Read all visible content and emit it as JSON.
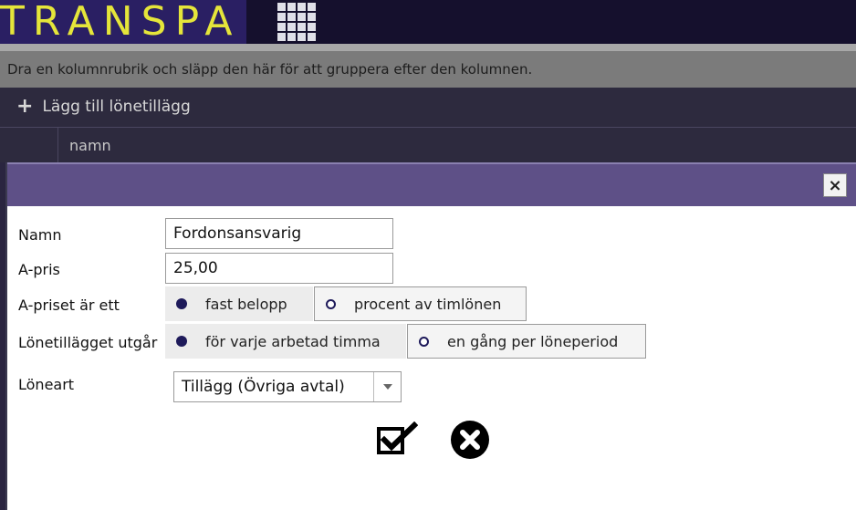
{
  "header": {
    "logo_text": "TRANSPA",
    "apps_icon": "grid-icon"
  },
  "grid": {
    "group_hint": "Dra en kolumnrubrik och släpp den här för att gruppera efter den kolumnen.",
    "add_label": "Lägg till lönetillägg",
    "column_name": "namn"
  },
  "dialog": {
    "close_label": "×",
    "fields": {
      "namn_label": "Namn",
      "namn_value": "Fordonsansvarig",
      "apris_label": "A-pris",
      "apris_value": "25,00",
      "apris_type_label": "A-priset är ett",
      "apris_opt1": "fast belopp",
      "apris_opt2": "procent av timlönen",
      "utgar_label": "Lönetillägget utgår",
      "utgar_opt1": "för varje arbetad timma",
      "utgar_opt2": "en gång per löneperiod",
      "loneart_label": "Löneart",
      "loneart_value": "Tillägg (Övriga avtal)"
    },
    "actions": {
      "save_icon": "check-box-icon",
      "cancel_icon": "x-circle-icon"
    }
  },
  "colors": {
    "logo_bg": "#2a1f63",
    "logo_text": "#e5e53a",
    "titlebar": "#5e5087",
    "radio_dot": "#1e1a5a"
  }
}
